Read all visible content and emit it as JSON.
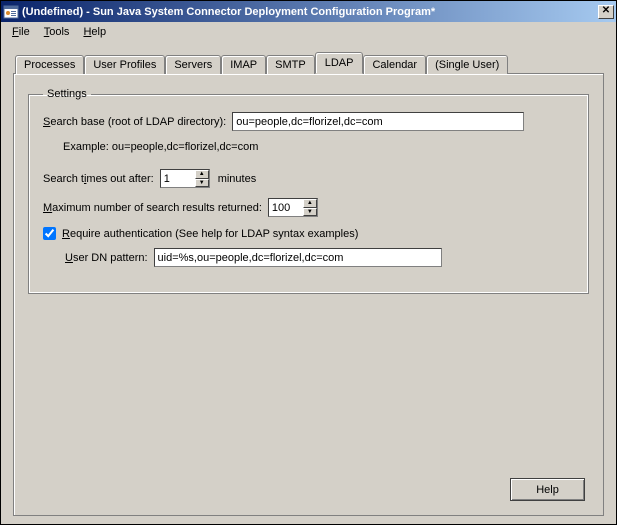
{
  "window": {
    "title": "(Undefined) - Sun Java System Connector Deployment Configuration Program*",
    "close_glyph": "✕"
  },
  "menubar": {
    "file": "File",
    "tools": "Tools",
    "help": "Help"
  },
  "tabs": {
    "processes": "Processes",
    "user_profiles": "User Profiles",
    "servers": "Servers",
    "imap": "IMAP",
    "smtp": "SMTP",
    "ldap": "LDAP",
    "calendar": "Calendar",
    "single_user": "(Single User)",
    "active": "ldap"
  },
  "ldap": {
    "group_label": "Settings",
    "search_base_label_pre": "S",
    "search_base_label_post": "earch base (root of LDAP directory):",
    "search_base_value": "ou=people,dc=florizel,dc=com",
    "example_text": "Example: ou=people,dc=florizel,dc=com",
    "timeout_label_pre": "Search t",
    "timeout_label_ul": "i",
    "timeout_label_post": "mes out after:",
    "timeout_value": "1",
    "timeout_units": "minutes",
    "max_results_label_pre": "M",
    "max_results_label_post": "aximum number of search results returned:",
    "max_results_value": "100",
    "require_auth_checked": true,
    "require_auth_label_pre": "R",
    "require_auth_label_post": "equire authentication (See help for LDAP syntax examples)",
    "user_dn_label_pre": "U",
    "user_dn_label_post": "ser DN pattern:",
    "user_dn_value": "uid=%s,ou=people,dc=florizel,dc=com"
  },
  "footer": {
    "help_label": "Help"
  }
}
